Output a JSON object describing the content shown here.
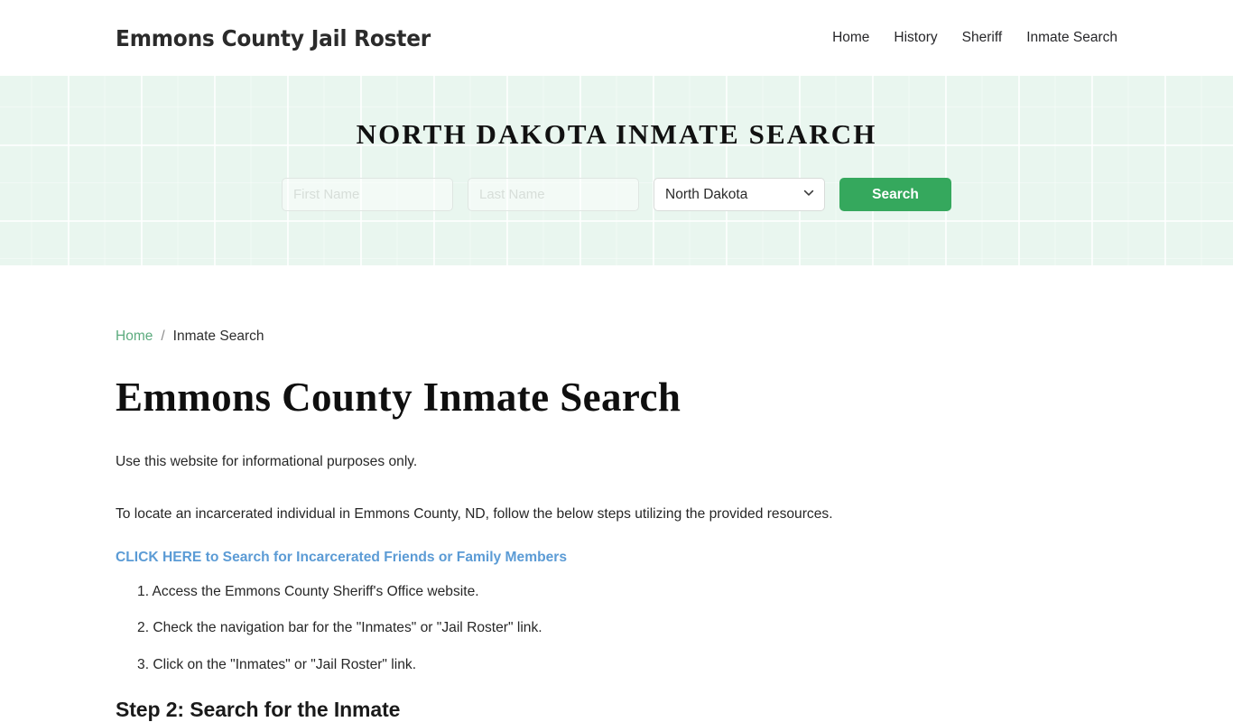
{
  "header": {
    "brand": "Emmons County Jail Roster",
    "nav": [
      {
        "label": "Home"
      },
      {
        "label": "History"
      },
      {
        "label": "Sheriff"
      },
      {
        "label": "Inmate Search"
      }
    ]
  },
  "hero": {
    "title": "NORTH DAKOTA INMATE SEARCH",
    "background_color": "#e9f6ef",
    "form": {
      "first_name": {
        "value": "",
        "placeholder": "First Name"
      },
      "last_name": {
        "value": "",
        "placeholder": "Last Name"
      },
      "state": {
        "selected": "North Dakota",
        "options": [
          "North Dakota"
        ],
        "chevron_icon": "chevron-down-icon"
      },
      "submit_label": "Search",
      "submit_color": "#35a85d"
    }
  },
  "main": {
    "breadcrumb": {
      "home_label": "Home",
      "separator": "/",
      "current_label": "Inmate Search",
      "link_color": "#5cab7e"
    },
    "page_title": "Emmons County Inmate Search",
    "paragraphs": [
      "Use this website for informational purposes only.",
      "To locate an incarcerated individual in Emmons County, ND, follow the below steps utilizing the provided resources."
    ],
    "cta_link": {
      "label": "CLICK HERE to Search for Incarcerated Friends or Family Members",
      "color": "#5b9bd5"
    },
    "steps": [
      "Access the Emmons County Sheriff's Office website.",
      "Check the navigation bar for the \"Inmates\" or \"Jail Roster\" link.",
      "Click on the \"Inmates\" or \"Jail Roster\" link."
    ],
    "section_heading": "Step 2: Search for the Inmate"
  }
}
